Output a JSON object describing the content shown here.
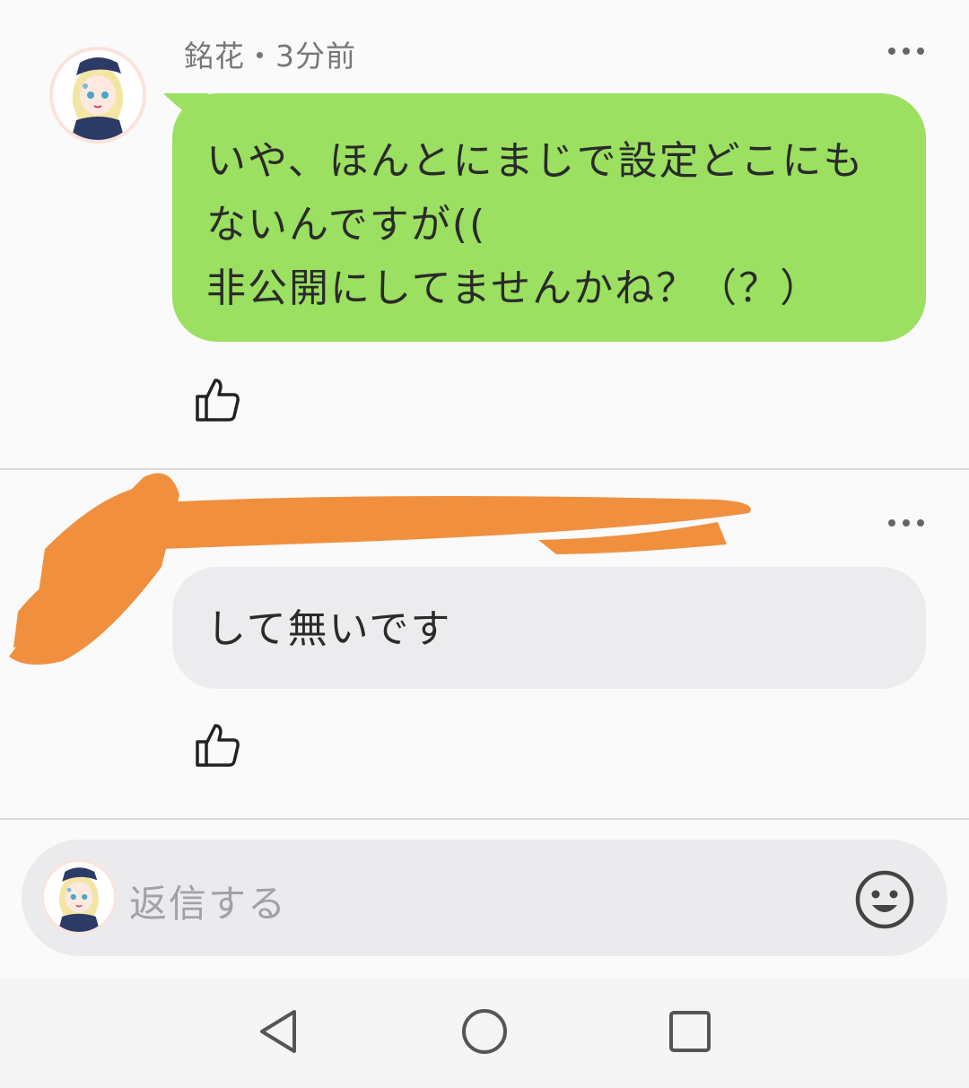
{
  "comments": [
    {
      "author": "銘花",
      "meta": "銘花・3分前",
      "text": "いや、ほんとにまじで設定どこにも\nないんですが((\n非公開にしてませんかね？（？）",
      "bubble_color": "#9be060"
    },
    {
      "text": "して無いです",
      "bubble_color": "#ececee"
    }
  ],
  "reply": {
    "placeholder": "返信する"
  },
  "icons": {
    "more": "more-dots-icon",
    "like": "thumbs-up-icon",
    "emoji": "smiley-icon",
    "nav": [
      "back-triangle-icon",
      "home-circle-icon",
      "recent-square-icon"
    ]
  },
  "colors": {
    "redaction": "#f0903f",
    "green_bubble": "#9be060",
    "grey_bubble": "#ececee"
  }
}
